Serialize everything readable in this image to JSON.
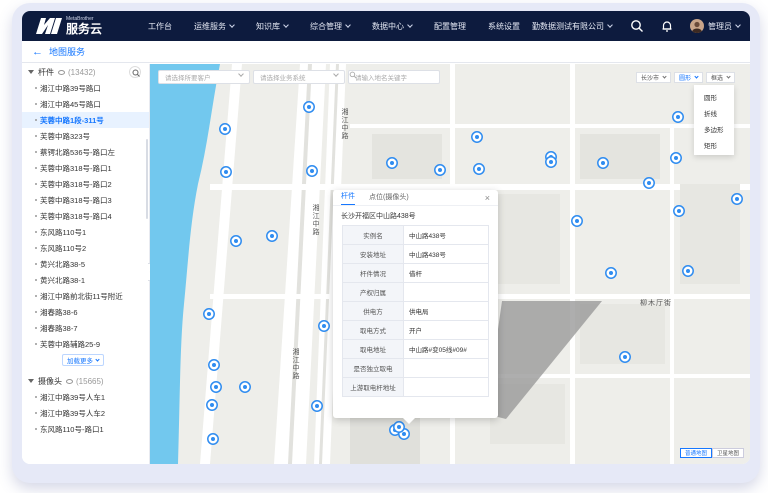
{
  "app": {
    "brand_en": "MetaBrother",
    "brand_cn": "服务云",
    "company": "勤数据测试有限公司",
    "user": "管理员"
  },
  "nav": {
    "items": [
      {
        "label": "工作台",
        "dropdown": false
      },
      {
        "label": "运维服务",
        "dropdown": true
      },
      {
        "label": "知识库",
        "dropdown": true
      },
      {
        "label": "综合管理",
        "dropdown": true
      },
      {
        "label": "数据中心",
        "dropdown": true
      },
      {
        "label": "配置管理",
        "dropdown": false
      },
      {
        "label": "系统设置",
        "dropdown": false
      }
    ]
  },
  "page": {
    "title": "地图服务"
  },
  "sidebar": {
    "poles": {
      "label": "杆件",
      "count": "(13432)",
      "items": [
        "湘江中路39号路口",
        "湘江中路45号路口",
        "芙蓉中路1段-311号",
        "芙蓉中路323号",
        "蔡锷北路536号-路口左",
        "芙蓉中路318号-路口1",
        "芙蓉中路318号-路口2",
        "芙蓉中路318号-路口3",
        "芙蓉中路318号-路口4",
        "东风路110号1",
        "东风路110号2",
        "黄兴北路38-5",
        "黄兴北路38-1",
        "湘江中路前北街11号附近",
        "湘春路38-6",
        "湘春路38-7",
        "芙蓉中路辅路25-9"
      ],
      "active_index": 2,
      "load_more": "加载更多"
    },
    "cameras": {
      "label": "摄像头",
      "count": "(15665)",
      "items": [
        "湘江中路39号人车1",
        "湘江中路39号人车2",
        "东风路110号-路口1"
      ]
    }
  },
  "filters": {
    "customer_placeholder": "请选择所要客户",
    "system_placeholder": "请选择业务系统",
    "search_placeholder": "请输入地名关键字"
  },
  "map_controls": {
    "city": "长沙市",
    "shape": "圆形",
    "select": "框选",
    "shape_options": [
      "圆形",
      "折线",
      "多边形",
      "矩形"
    ],
    "map_types": [
      "普通地图",
      "卫星地图"
    ],
    "active_map_type": 0
  },
  "map_labels": {
    "road1": "湘江中路",
    "road2": "湘江中路",
    "road3": "湘江中路",
    "place1": "柳木厅街"
  },
  "popup": {
    "tabs": [
      "杆件",
      "点位(摄像头)"
    ],
    "active_tab": 0,
    "address": "长沙开福区中山路438号",
    "rows": [
      {
        "key": "实例名",
        "value": "中山路438号"
      },
      {
        "key": "安装地址",
        "value": "中山路438号"
      },
      {
        "key": "杆件情况",
        "value": "借杆"
      },
      {
        "key": "产权归属",
        "value": ""
      },
      {
        "key": "供电方",
        "value": "供电局"
      },
      {
        "key": "取电方式",
        "value": "开户"
      },
      {
        "key": "取电地址",
        "value": "中山路#变05线#09#"
      },
      {
        "key": "是否独立取电",
        "value": ""
      },
      {
        "key": "上游取电杆地址",
        "value": ""
      }
    ]
  },
  "colors": {
    "nav_bg": "#0d1b3e",
    "accent": "#1677ff",
    "river": "#72c8ee",
    "map_bg": "#eeeeea",
    "pin": "#2f8cf0"
  }
}
